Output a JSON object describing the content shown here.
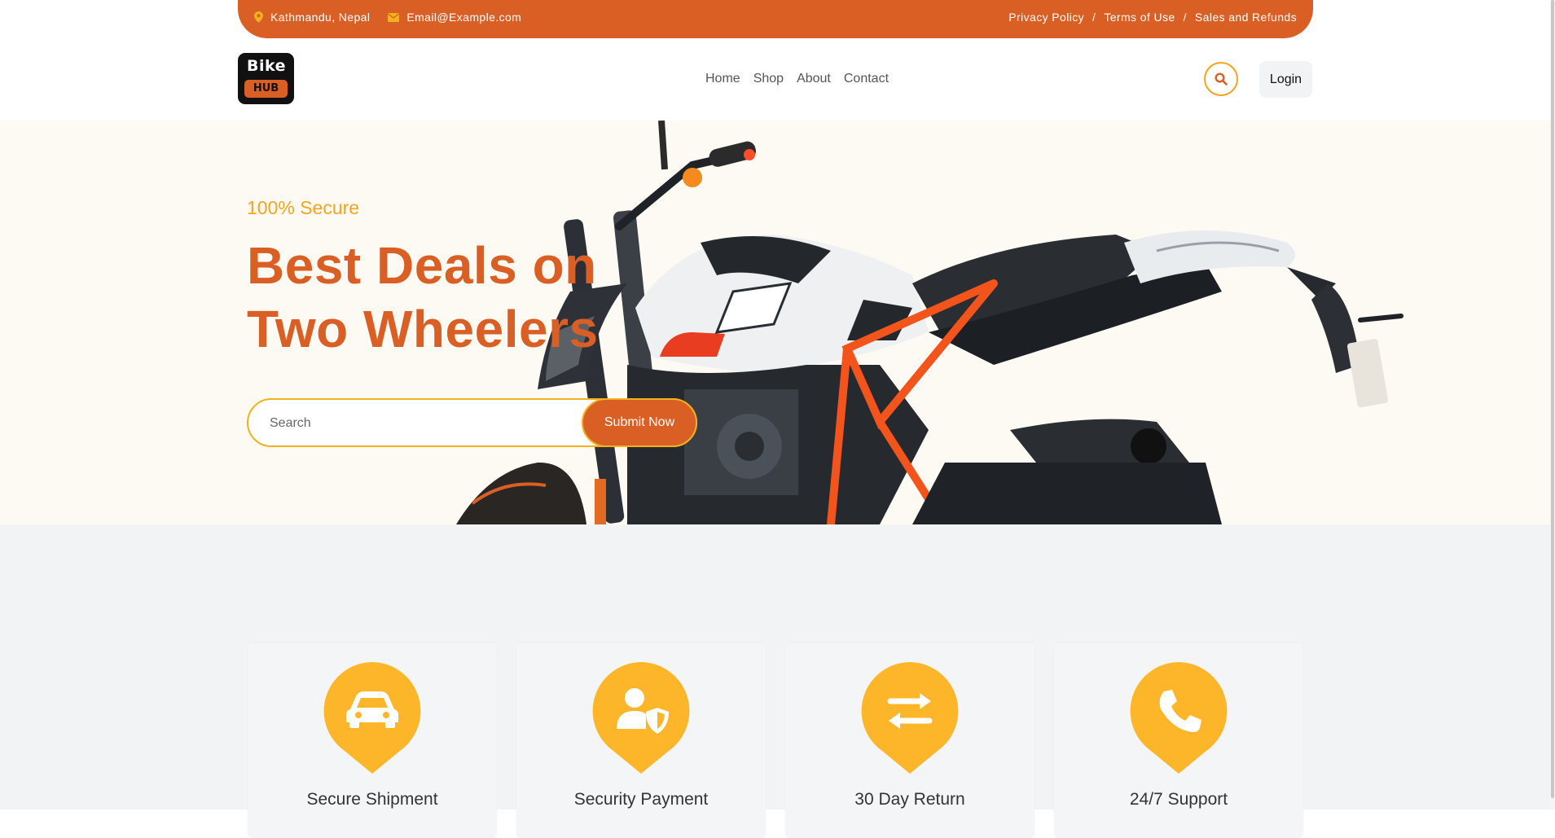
{
  "topbar": {
    "location": "Kathmandu, Nepal",
    "email": "Email@Example.com",
    "links": [
      "Privacy Policy",
      "Terms of Use",
      "Sales and Refunds"
    ],
    "separator": "/"
  },
  "logo": {
    "line1": "Bike",
    "line2": "HUB"
  },
  "nav": [
    "Home",
    "Shop",
    "About",
    "Contact"
  ],
  "header": {
    "login_label": "Login",
    "search_icon": "search-icon"
  },
  "hero": {
    "kicker": "100% Secure",
    "title_line1": "Best Deals on",
    "title_line2": "Two Wheelers",
    "search_placeholder": "Search",
    "submit_label": "Submit Now"
  },
  "features": [
    {
      "title": "Secure Shipment",
      "icon": "car-icon"
    },
    {
      "title": "Security Payment",
      "icon": "user-shield-icon"
    },
    {
      "title": "30 Day Return",
      "icon": "exchange-arrows-icon"
    },
    {
      "title": "24/7 Support",
      "icon": "phone-icon"
    }
  ],
  "colors": {
    "brand": "#d95f24",
    "accent": "#f2a51f",
    "accent_yellow": "#fdb62a"
  }
}
